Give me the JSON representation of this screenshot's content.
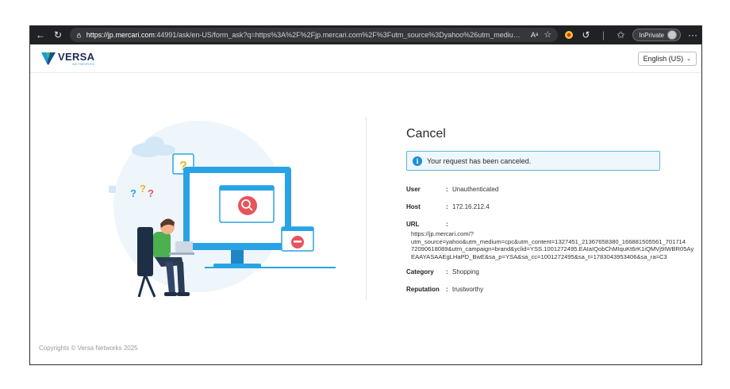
{
  "browser": {
    "url_host": "https://jp.mercari.com",
    "url_rest": ":44991/ask/en-US/form_ask?q=https%3A%2F%2Fjp.mercari.com%2F%3Futm_source%3Dyahoo%26utm_medium%3Dcpc%26utm_content%3D1327451_2136...",
    "inprivate_label": "InPrivate"
  },
  "header": {
    "logo_text": "VERSA",
    "logo_subtext": "NETWORKS",
    "language": "English (US)"
  },
  "main": {
    "title": "Cancel",
    "alert": "Your request has been canceled.",
    "details": {
      "user_label": "User",
      "user_value": "Unauthenticated",
      "host_label": "Host",
      "host_value": "172.16.212.4",
      "url_label": "URL",
      "url_lines": [
        "https://jp.mercari.com/?",
        "utm_source=yahoo&utm_medium=cpc&utm_content=1327451_21367658380_166881505561_701714",
        "72090618089&utm_campaign=brand&yclid=YSS.1001272495.EAIaIQobChMIquKt6rK1iQMVj9IWBR05Ay",
        "EAAYASAAEgLHaPD_BwE&sa_p=YSA&sa_cc=1001272495&sa_t=1783043953406&sa_ra=C3"
      ],
      "category_label": "Category",
      "category_value": "Shopping",
      "reputation_label": "Reputation",
      "reputation_value": "trustworthy"
    }
  },
  "footer": {
    "copyright": "Copyrights © Versa Networks 2025"
  },
  "colors": {
    "accent": "#1d8fd1",
    "alert_border": "#62b4dc",
    "monitor": "#2aa3e6"
  },
  "icons": [
    "back-arrow-icon",
    "refresh-icon",
    "lock-icon",
    "read-aloud-icon",
    "favorite-star-icon",
    "extension-icon",
    "copilot-icon",
    "favorites-icon",
    "more-icon",
    "info-icon",
    "chevron-down-icon"
  ]
}
